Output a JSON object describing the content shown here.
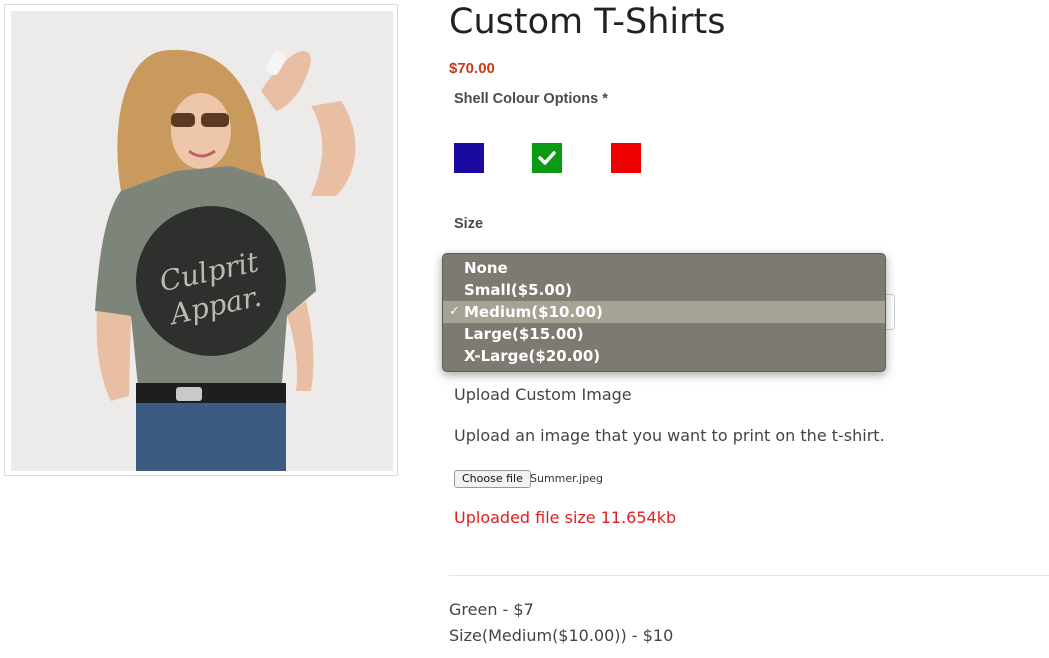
{
  "product": {
    "title": "Custom T-Shirts",
    "price": "$70.00",
    "image_alt": "Model wearing a grey t-shirt with \"Culprit Apparel\" print"
  },
  "colour_options": {
    "label": "Shell Colour Options *",
    "swatches": [
      {
        "name": "Blue",
        "color": "#1a0aa0",
        "selected": false
      },
      {
        "name": "Green",
        "color": "#0a9a14",
        "selected": true
      },
      {
        "name": "Red",
        "color": "#ef0000",
        "selected": false
      }
    ]
  },
  "size": {
    "label": "Size",
    "options": [
      "None",
      "Small($5.00)",
      "Medium($10.00)",
      "Large($15.00)",
      "X-Large($20.00)"
    ],
    "selected": "Medium($10.00)",
    "check_mark": "✓"
  },
  "upload": {
    "heading": "Upload Custom Image",
    "description": "Upload an image that you want to print on the t-shirt.",
    "button_label": "Choose file",
    "file_name": "Summer.jpeg",
    "status": "Uploaded file size 11.654kb"
  },
  "summary": {
    "lines": [
      "Green - $7",
      "Size(Medium($10.00)) - $10"
    ]
  },
  "colors": {
    "price": "#c83a1a",
    "error": "#e02020",
    "dropdown_bg": "#7d7a72",
    "dropdown_highlight": "#a6a394"
  }
}
